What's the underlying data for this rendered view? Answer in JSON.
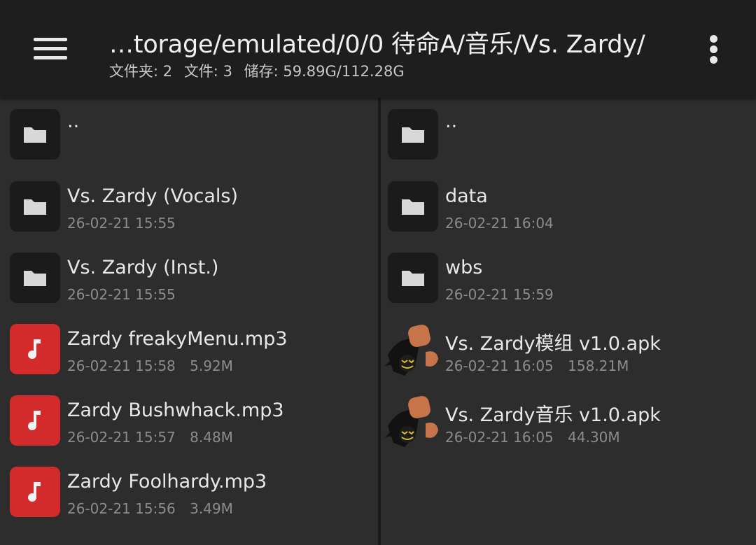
{
  "header": {
    "title": "…torage/emulated/0/0 待命A/音乐/Vs. Zardy/",
    "folders": "文件夹: 2",
    "files": "文件: 3",
    "storage": "储存: 59.89G/112.28G"
  },
  "left_pane": {
    "up": "..",
    "items": [
      {
        "name": "Vs. Zardy (Vocals)",
        "date": "26-02-21 15:55",
        "size": "",
        "icon": "folder-icon"
      },
      {
        "name": "Vs. Zardy (Inst.)",
        "date": "26-02-21 15:55",
        "size": "",
        "icon": "folder-icon"
      },
      {
        "name": "Zardy freakyMenu.mp3",
        "date": "26-02-21 15:58",
        "size": "5.92M",
        "icon": "music-note-icon"
      },
      {
        "name": "Zardy Bushwhack.mp3",
        "date": "26-02-21 15:57",
        "size": "8.48M",
        "icon": "music-note-icon"
      },
      {
        "name": "Zardy Foolhardy.mp3",
        "date": "26-02-21 15:56",
        "size": "3.49M",
        "icon": "music-note-icon"
      }
    ]
  },
  "right_pane": {
    "up": "..",
    "items": [
      {
        "name": "data",
        "date": "26-02-21 16:04",
        "size": "",
        "icon": "folder-icon"
      },
      {
        "name": "wbs",
        "date": "26-02-21 15:59",
        "size": "",
        "icon": "folder-icon"
      },
      {
        "name": "Vs. Zardy模组 v1.0.apk",
        "date": "26-02-21 16:05",
        "size": "158.21M",
        "icon": "apk-app-icon"
      },
      {
        "name": "Vs. Zardy音乐 v1.0.apk",
        "date": "26-02-21 16:05",
        "size": "44.30M",
        "icon": "apk-app-icon"
      }
    ]
  },
  "colors": {
    "appbar": "#1e1e1e",
    "pane": "#2d2d2d",
    "audio_icon": "#d32b2b",
    "folder_icon_bg": "#1b1b1b"
  }
}
